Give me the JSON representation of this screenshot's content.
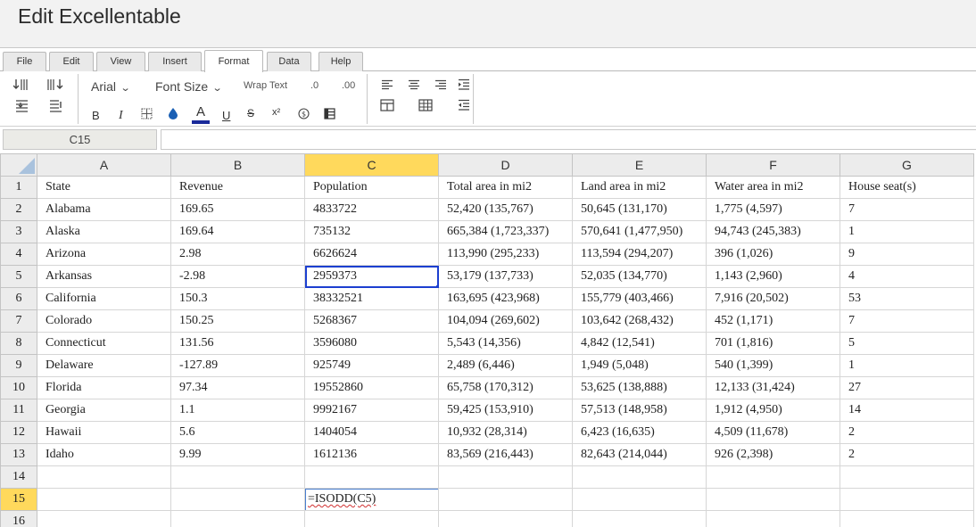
{
  "window": {
    "title": "Edit Excellentable"
  },
  "menu": {
    "tabs": [
      {
        "label": "File"
      },
      {
        "label": "Edit"
      },
      {
        "label": "View"
      },
      {
        "label": "Insert"
      },
      {
        "label": "Format",
        "active": true
      },
      {
        "label": "Data"
      },
      {
        "label": "Help"
      }
    ]
  },
  "toolbar": {
    "font_family": "Arial",
    "font_size": "Font Size",
    "wrap_text": "Wrap Text",
    "decrease_decimal": ".0",
    "increase_decimal": ".00",
    "bold": "B",
    "italic": "I",
    "text_color": "A",
    "underline": "U",
    "strikethrough": "S",
    "superscript": "x²",
    "icons": [
      "insert-row-icon",
      "insert-column-icon",
      "delete-row-icon",
      "delete-column-icon",
      "border-icon",
      "fill-color-icon",
      "currency-icon",
      "table-format-icon",
      "align-left-icon",
      "align-center-icon",
      "align-right-icon",
      "indent-icon",
      "merge-cells-icon",
      "grid-icon",
      "outdent-icon"
    ],
    "colors": {
      "text_color_bar": "#1a2a9a",
      "fill_icon": "#1a5fb4"
    }
  },
  "formula_bar": {
    "name_box": "C15",
    "formula": ""
  },
  "sheet": {
    "columns": [
      "A",
      "B",
      "C",
      "D",
      "E",
      "F",
      "G"
    ],
    "selected_column": "C",
    "selected_row": "15",
    "rows": [
      {
        "n": "1",
        "cells": [
          "State",
          "Revenue",
          "Population",
          "Total area in mi2",
          "Land area in mi2",
          "Water area in mi2",
          "House seat(s)"
        ]
      },
      {
        "n": "2",
        "cells": [
          "Alabama",
          "169.65",
          "4833722",
          "52,420 (135,767)",
          "50,645 (131,170)",
          "1,775 (4,597)",
          "7"
        ]
      },
      {
        "n": "3",
        "cells": [
          "Alaska",
          "169.64",
          "735132",
          "665,384 (1,723,337)",
          "570,641 (1,477,950)",
          "94,743 (245,383)",
          "1"
        ]
      },
      {
        "n": "4",
        "cells": [
          "Arizona",
          "2.98",
          "6626624",
          "113,990 (295,233)",
          "113,594 (294,207)",
          "396 (1,026)",
          "9"
        ]
      },
      {
        "n": "5",
        "cells": [
          "Arkansas",
          "-2.98",
          "2959373",
          "53,179 (137,733)",
          "52,035 (134,770)",
          "1,143 (2,960)",
          "4"
        ]
      },
      {
        "n": "6",
        "cells": [
          "California",
          "150.3",
          "38332521",
          "163,695 (423,968)",
          "155,779 (403,466)",
          "7,916 (20,502)",
          "53"
        ]
      },
      {
        "n": "7",
        "cells": [
          "Colorado",
          "150.25",
          "5268367",
          "104,094 (269,602)",
          "103,642 (268,432)",
          "452 (1,171)",
          "7"
        ]
      },
      {
        "n": "8",
        "cells": [
          "Connecticut",
          "131.56",
          "3596080",
          "5,543 (14,356)",
          "4,842 (12,541)",
          "701 (1,816)",
          "5"
        ]
      },
      {
        "n": "9",
        "cells": [
          "Delaware",
          "-127.89",
          "925749",
          "2,489 (6,446)",
          "1,949 (5,048)",
          "540 (1,399)",
          "1"
        ]
      },
      {
        "n": "10",
        "cells": [
          "Florida",
          "97.34",
          "19552860",
          "65,758 (170,312)",
          "53,625 (138,888)",
          "12,133 (31,424)",
          "27"
        ]
      },
      {
        "n": "11",
        "cells": [
          "Georgia",
          "1.1",
          "9992167",
          "59,425 (153,910)",
          "57,513 (148,958)",
          "1,912 (4,950)",
          "14"
        ]
      },
      {
        "n": "12",
        "cells": [
          "Hawaii",
          "5.6",
          "1404054",
          "10,932 (28,314)",
          "6,423 (16,635)",
          "4,509 (11,678)",
          "2"
        ]
      },
      {
        "n": "13",
        "cells": [
          "Idaho",
          "9.99",
          "1612136",
          "83,569 (216,443)",
          "82,643 (214,044)",
          "926 (2,398)",
          "2"
        ]
      },
      {
        "n": "14",
        "cells": [
          "",
          "",
          "",
          "",
          "",
          "",
          ""
        ]
      },
      {
        "n": "15",
        "cells": [
          "",
          "",
          "",
          "",
          "",
          "",
          ""
        ]
      },
      {
        "n": "16",
        "cells": [
          "",
          "",
          "",
          "",
          "",
          "",
          ""
        ]
      }
    ],
    "editing_cell": {
      "ref": "C15",
      "value": "=ISODD(C5)"
    }
  }
}
